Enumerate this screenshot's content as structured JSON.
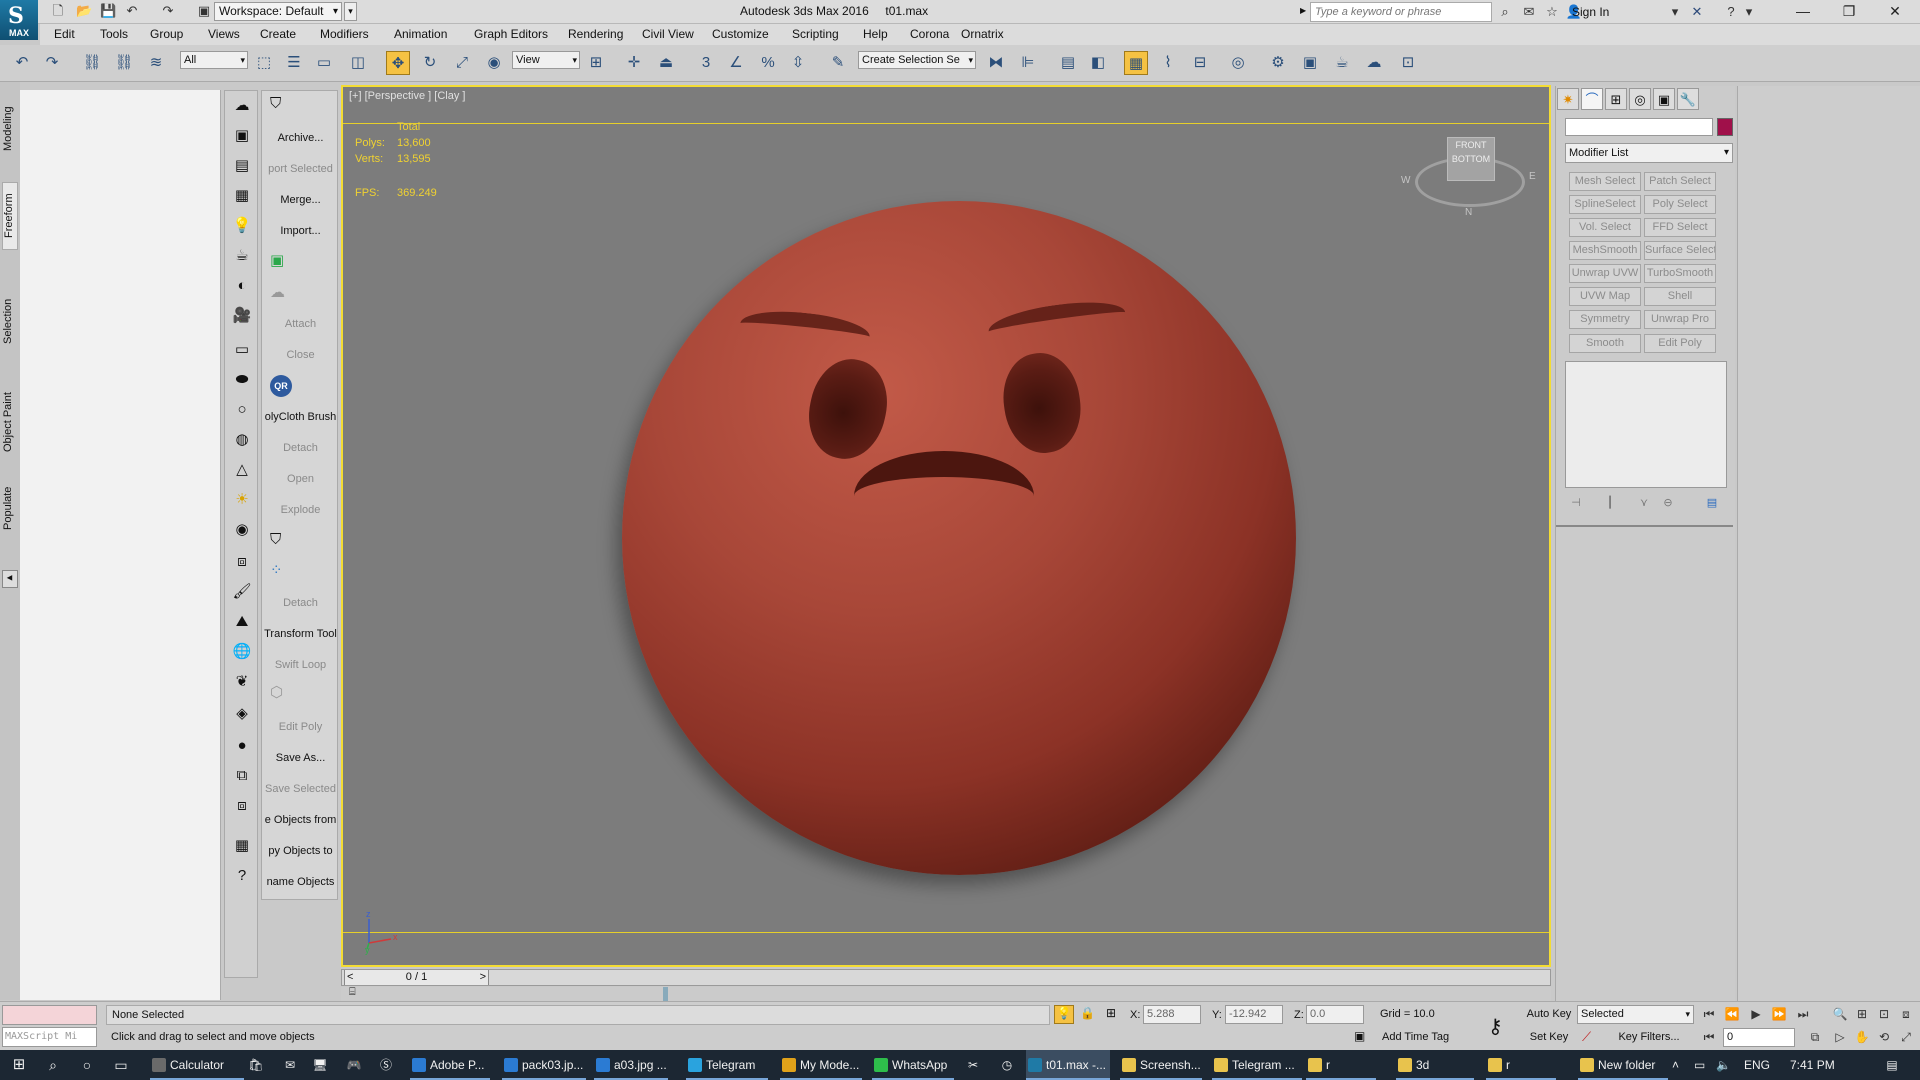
{
  "window": {
    "app_name": "Autodesk 3ds Max 2016",
    "file_name": "t01.max",
    "workspace": "Workspace: Default",
    "search_placeholder": "Type a keyword or phrase",
    "sign_in": "Sign In",
    "logo_text": "MAX"
  },
  "menu": [
    "Edit",
    "Tools",
    "Group",
    "Views",
    "Create",
    "Modifiers",
    "Animation",
    "Graph Editors",
    "Rendering",
    "Civil View",
    "Customize",
    "Scripting",
    "Help",
    "Corona",
    "Ornatrix"
  ],
  "toolbar": {
    "selection_filter": "All",
    "ref_coord": "View",
    "named_selection": "Create Selection Se"
  },
  "ribbon_tabs": [
    "Modeling",
    "Freeform",
    "Selection",
    "Object Paint",
    "Populate"
  ],
  "command_panel_items": [
    {
      "label": "Archive...",
      "enabled": true
    },
    {
      "label": "port Selected",
      "enabled": false
    },
    {
      "label": "Merge...",
      "enabled": true
    },
    {
      "label": "Import...",
      "enabled": true
    },
    {
      "label": "Attach",
      "enabled": false
    },
    {
      "label": "Close",
      "enabled": false
    },
    {
      "label": "olyCloth Brush",
      "enabled": true
    },
    {
      "label": "Detach",
      "enabled": false
    },
    {
      "label": "Open",
      "enabled": false
    },
    {
      "label": "Explode",
      "enabled": false
    },
    {
      "label": "Detach",
      "enabled": false
    },
    {
      "label": "Transform Tool",
      "enabled": true
    },
    {
      "label": "Swift Loop",
      "enabled": false
    },
    {
      "label": "Edit Poly",
      "enabled": false
    },
    {
      "label": "Save As...",
      "enabled": true
    },
    {
      "label": "Save Selected",
      "enabled": false
    },
    {
      "label": "e Objects from",
      "enabled": true
    },
    {
      "label": "py Objects to",
      "enabled": true
    },
    {
      "label": "name Objects",
      "enabled": true
    }
  ],
  "qr_label": "QR",
  "viewport": {
    "label": "[+] [Perspective ] [Clay ]",
    "stats": {
      "total_label": "Total",
      "polys_label": "Polys:",
      "polys": "13,600",
      "verts_label": "Verts:",
      "verts": "13,595",
      "fps_label": "FPS:",
      "fps": "369.249"
    },
    "viewcube_top": "FRONT",
    "viewcube_bottom": "BOTTOM",
    "compass": {
      "w": "W",
      "e": "E",
      "n": "N"
    },
    "axis": {
      "x": "x",
      "y": "y",
      "z": "z"
    },
    "object_color": "#a84738"
  },
  "timeslider": {
    "frame": "0 / 1",
    "prev": "<",
    "next": ">"
  },
  "modify_panel": {
    "object_color": "#a0104a",
    "modifier_list": "Modifier List",
    "buttons": [
      "Mesh Select",
      "Patch Select",
      "SplineSelect",
      "Poly Select",
      "Vol. Select",
      "FFD Select",
      "MeshSmooth",
      "Surface Select",
      "Unwrap UVW",
      "TurboSmooth",
      "UVW Map",
      "Shell",
      "Symmetry",
      "Unwrap Pro",
      "Smooth",
      "Edit Poly"
    ]
  },
  "status": {
    "maxscript": "MAXScript Mi",
    "selection": "None Selected",
    "prompt": "Click and drag to select and move objects",
    "x_label": "X:",
    "x": "5.288",
    "y_label": "Y:",
    "y": "-12.942",
    "z_label": "Z:",
    "z": "0.0",
    "grid": "Grid = 10.0",
    "add_time_tag": "Add Time Tag",
    "auto_key": "Auto Key",
    "set_key": "Set Key",
    "key_selected": "Selected",
    "key_filters": "Key Filters...",
    "frame": "0"
  },
  "taskbar": {
    "items": [
      {
        "label": "Calculator",
        "color": "#6a6a6a",
        "state": "running"
      },
      {
        "label": "Adobe P...",
        "color": "#2b7bd3",
        "state": "running"
      },
      {
        "label": "pack03.jp...",
        "color": "#2b7bd3",
        "state": "running"
      },
      {
        "label": "a03.jpg ...",
        "color": "#2b7bd3",
        "state": "running"
      },
      {
        "label": "Telegram",
        "color": "#2aa3de",
        "state": "running"
      },
      {
        "label": "My Mode...",
        "color": "#e0a21a",
        "state": "running"
      },
      {
        "label": "WhatsApp",
        "color": "#2ebd4b",
        "state": "running"
      },
      {
        "label": "t01.max -...",
        "color": "#1f7aa6",
        "state": "active"
      },
      {
        "label": "Screensh...",
        "color": "#e8c34d",
        "state": "running"
      },
      {
        "label": "Telegram ...",
        "color": "#e8c34d",
        "state": "running"
      },
      {
        "label": "r",
        "color": "#e8c34d",
        "state": "running"
      },
      {
        "label": "3d",
        "color": "#e8c34d",
        "state": "running"
      },
      {
        "label": "r",
        "color": "#e8c34d",
        "state": "running"
      },
      {
        "label": "New folder",
        "color": "#e8c34d",
        "state": "running"
      }
    ],
    "lang": "ENG",
    "time": "7:41 PM"
  }
}
